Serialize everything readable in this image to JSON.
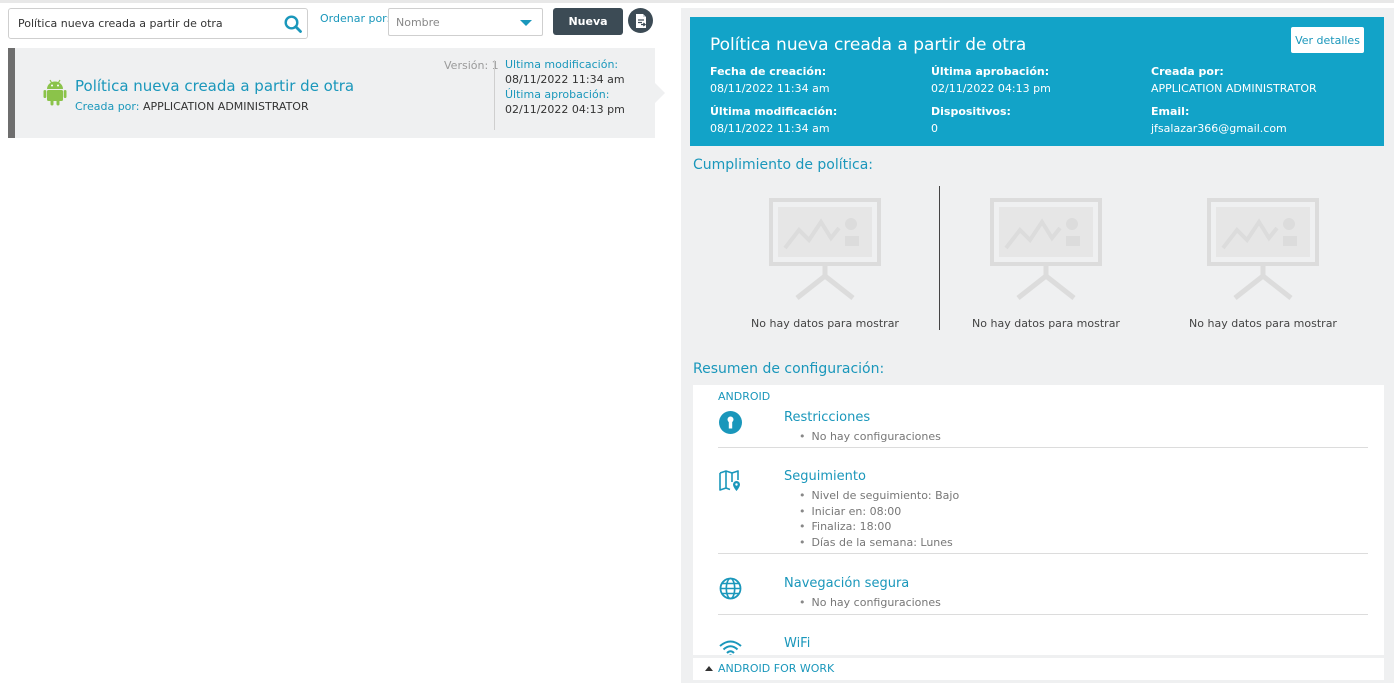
{
  "search": {
    "value": "Política nueva creada a partir de otra"
  },
  "sort": {
    "label": "Ordenar por:",
    "selected": "Nombre"
  },
  "toolbar": {
    "new_label": "Nueva"
  },
  "policy_card": {
    "title": "Política nueva creada a partir de otra",
    "created_by_label": "Creada por:",
    "created_by": "APPLICATION ADMINISTRATOR",
    "version": "Versión: 1",
    "last_modified_label": "Ultima modificación:",
    "last_modified": "08/11/2022 11:34 am",
    "last_approval_label": "Última aprobación:",
    "last_approval": "02/11/2022 04:13 pm"
  },
  "detail": {
    "title": "Política nueva creada a partir de otra",
    "details_button": "Ver detalles",
    "fields": {
      "created_date_label": "Fecha de creación:",
      "created_date": "08/11/2022 11:34 am",
      "last_approval_label": "Última aprobación:",
      "last_approval": "02/11/2022 04:13 pm",
      "created_by_label": "Creada por:",
      "created_by": "APPLICATION ADMINISTRATOR",
      "last_modified_label": "Última modificación:",
      "last_modified": "08/11/2022 11:34 am",
      "devices_label": "Dispositivos:",
      "devices": "0",
      "email_label": "Email:",
      "email": "jfsalazar366@gmail.com"
    }
  },
  "compliance": {
    "title": "Cumplimiento de política:",
    "no_data": [
      "No hay datos para mostrar",
      "No hay datos para mostrar",
      "No hay datos para mostrar"
    ]
  },
  "config_summary": {
    "title": "Resumen de configuración:",
    "platform": "ANDROID",
    "items": [
      {
        "name": "Restricciones",
        "icon": "keyhole-icon",
        "bullets": [
          "No hay configuraciones"
        ]
      },
      {
        "name": "Seguimiento",
        "icon": "map-pin-icon",
        "bullets": [
          "Nivel de seguimiento: Bajo",
          "Iniciar en: 08:00",
          "Finaliza: 18:00",
          "Días de la semana: Lunes"
        ]
      },
      {
        "name": "Navegación segura",
        "icon": "globe-icon",
        "bullets": [
          "No hay configuraciones"
        ]
      },
      {
        "name": "WiFi",
        "icon": "wifi-icon",
        "bullets": []
      }
    ],
    "footer_platform": "ANDROID FOR WORK"
  },
  "colors": {
    "accent": "#1a97bb",
    "header_bg": "#12a3c8",
    "button_dark": "#3c4b55",
    "android_green": "#8bc34a"
  }
}
